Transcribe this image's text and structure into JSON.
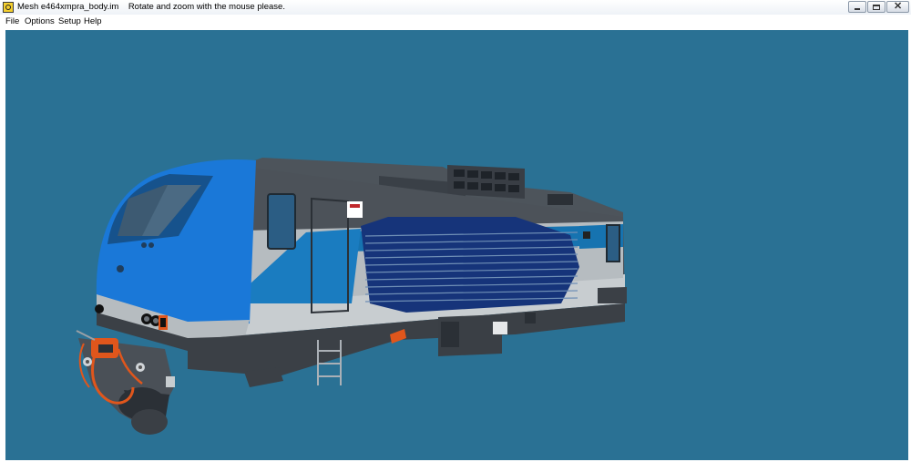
{
  "window": {
    "title": "Mesh e464xmpra_body.im",
    "hint": "Rotate and zoom with the mouse please.",
    "app_icon": "app-icon",
    "buttons": {
      "minimize": "minimize-icon",
      "maximize": "maximize-icon",
      "close": "close-icon"
    }
  },
  "menu": {
    "items": [
      {
        "label": "File"
      },
      {
        "label": "Options"
      },
      {
        "label": "Setup"
      },
      {
        "label": "Help"
      }
    ]
  },
  "viewport": {
    "background": "#2a7194",
    "model": "locomotive-3d-model",
    "colors": {
      "cab_blue": "#1a78d8",
      "stripe_blue": "#1673b0",
      "dark_navy": "#16347a",
      "silver": "#c8cdd0",
      "roof_gray": "#4d545b",
      "underframe": "#3b4046",
      "coupler_orange": "#e0561c"
    }
  }
}
